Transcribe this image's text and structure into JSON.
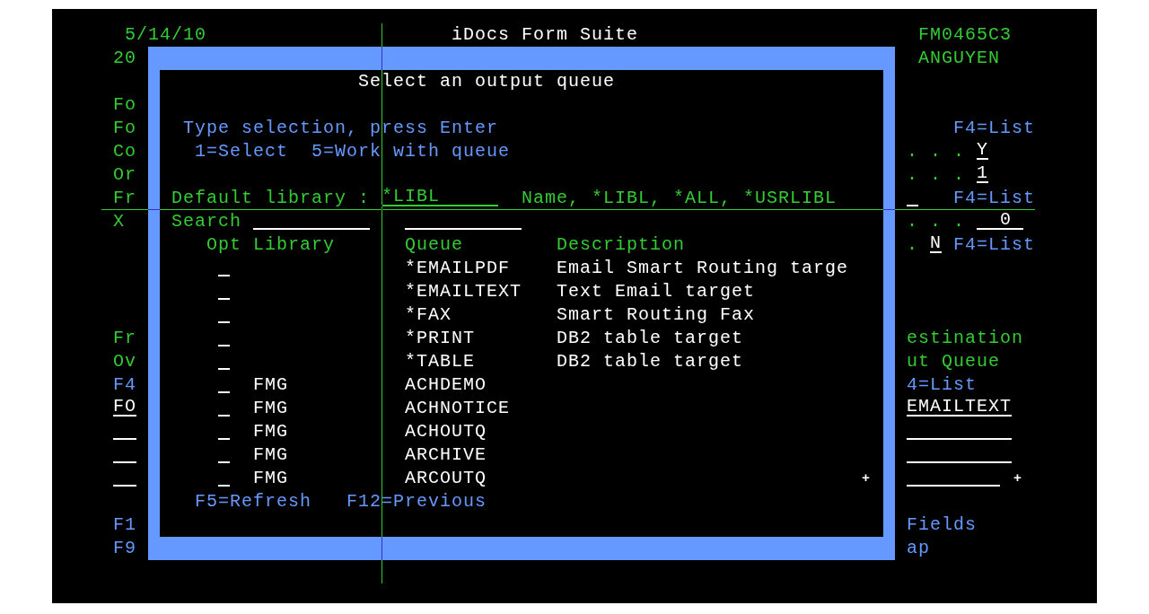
{
  "header": {
    "date": "5/14/10",
    "title": "iDocs Form Suite",
    "program": "FM0465C3"
  },
  "background_rows": [
    {
      "left": {
        "kind": "label",
        "text": "20"
      },
      "right": [
        {
          "kind": "label",
          "text": "ANGUYEN"
        }
      ]
    },
    {
      "left": {
        "kind": "label",
        "text": "Fo"
      }
    },
    {
      "left": {
        "kind": "label",
        "text": "Fo"
      },
      "right": [
        {
          "kind": "hint",
          "text": "F4=List"
        }
      ]
    },
    {
      "left": {
        "kind": "label",
        "text": "Co"
      },
      "right": [
        {
          "kind": "leader",
          "text": ". . ."
        },
        {
          "kind": "field",
          "value": "Y"
        }
      ]
    },
    {
      "left": {
        "kind": "label",
        "text": "Or"
      },
      "right": [
        {
          "kind": "leader",
          "text": ". . ."
        },
        {
          "kind": "field",
          "value": "1"
        }
      ]
    },
    {
      "left": {
        "kind": "label",
        "text": "Fr"
      },
      "right": [
        {
          "kind": "field"
        },
        {
          "kind": "hint",
          "text": "F4=List"
        }
      ]
    },
    {
      "left": {
        "kind": "label",
        "text": "X"
      },
      "right": [
        {
          "kind": "leader",
          "text": ". . ."
        },
        {
          "kind": "field",
          "value": "0"
        }
      ]
    },
    {
      "right": [
        {
          "kind": "leader",
          "text": "."
        },
        {
          "kind": "field",
          "value": "N"
        },
        {
          "kind": "hint",
          "text": "F4=List"
        }
      ]
    },
    {
      "left": {
        "kind": "label",
        "text": "Fr"
      },
      "right": [
        {
          "kind": "label",
          "text": "estination"
        }
      ]
    },
    {
      "left": {
        "kind": "label",
        "text": "Ov"
      },
      "right": [
        {
          "kind": "label",
          "text": "ut Queue"
        }
      ]
    },
    {
      "left": {
        "kind": "hint",
        "text": "F4"
      },
      "right": [
        {
          "kind": "hint",
          "text": "4=List"
        }
      ]
    },
    {
      "left": {
        "kind": "field",
        "value": "FO"
      },
      "right": [
        {
          "kind": "field",
          "value": "EMAILTEXT"
        }
      ]
    },
    {
      "left": {
        "kind": "field"
      },
      "right": [
        {
          "kind": "field"
        }
      ]
    },
    {
      "left": {
        "kind": "field"
      },
      "right": [
        {
          "kind": "field"
        }
      ]
    },
    {
      "left": {
        "kind": "field"
      },
      "right": [
        {
          "kind": "field"
        },
        {
          "kind": "more",
          "text": "+"
        }
      ]
    },
    {
      "left": {
        "kind": "hint",
        "text": "F1"
      },
      "right": [
        {
          "kind": "hint",
          "text": "Fields"
        }
      ]
    },
    {
      "left": {
        "kind": "hint",
        "text": "F9"
      },
      "right": [
        {
          "kind": "hint",
          "text": "ap"
        }
      ]
    }
  ],
  "popup": {
    "title": "Select an output queue",
    "instruction": "Type selection, press Enter",
    "options": [
      "1=Select",
      "5=Work with queue"
    ],
    "default_library": {
      "label": "Default library :",
      "value": "*LIBL",
      "hint": "Name, *LIBL, *ALL, *USRLIBL"
    },
    "search": {
      "label": "Search"
    },
    "table": {
      "columns": [
        "Opt",
        "Library",
        "Queue",
        "Description"
      ],
      "rows": [
        {
          "queue": "*EMAILPDF",
          "description": "Email Smart Routing targe"
        },
        {
          "queue": "*EMAILTEXT",
          "description": "Text Email target"
        },
        {
          "queue": "*FAX",
          "description": "Smart Routing Fax"
        },
        {
          "queue": "*PRINT",
          "description": "DB2 table target"
        },
        {
          "queue": "*TABLE",
          "description": "DB2 table target"
        },
        {
          "library": "FMG",
          "queue": "ACHDEMO"
        },
        {
          "library": "FMG",
          "queue": "ACHNOTICE"
        },
        {
          "library": "FMG",
          "queue": "ACHOUTQ"
        },
        {
          "library": "FMG",
          "queue": "ARCHIVE"
        },
        {
          "library": "FMG",
          "queue": "ARCOUTQ"
        }
      ],
      "more_indicator": "+"
    },
    "function_keys": [
      "F5=Refresh",
      "F12=Previous"
    ]
  }
}
